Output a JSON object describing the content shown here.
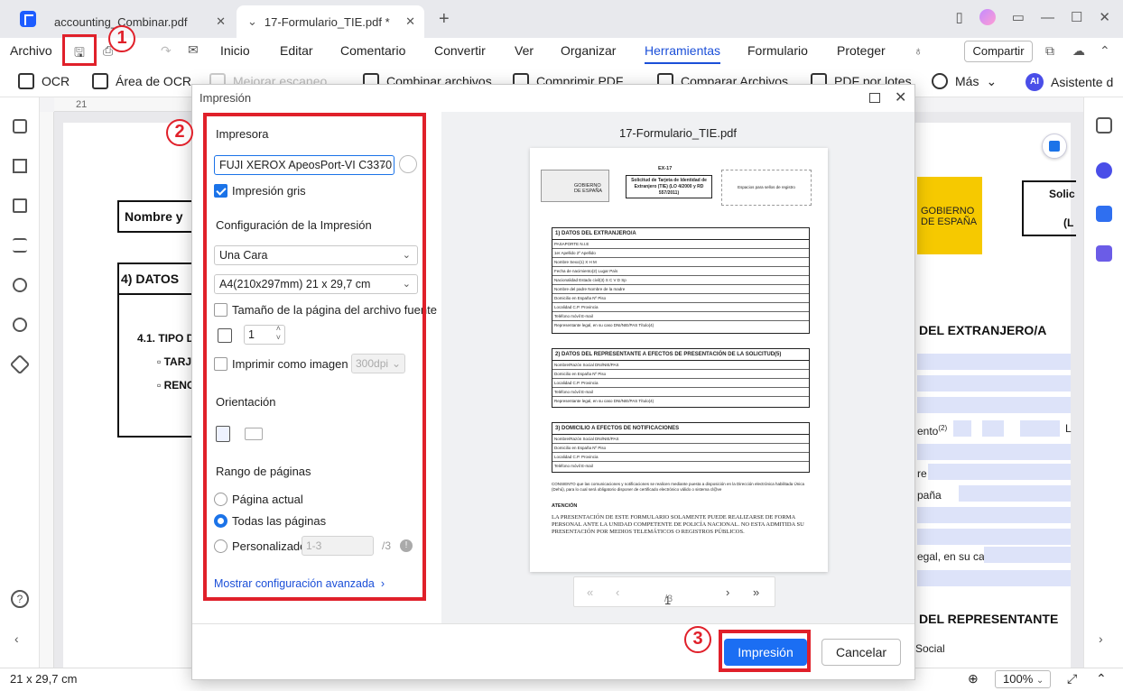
{
  "tabs": [
    {
      "label": "accounting_Combinar.pdf"
    },
    {
      "label": "17-Formulario_TIE.pdf *"
    }
  ],
  "menu": {
    "archivo": "Archivo",
    "items": [
      "Inicio",
      "Editar",
      "Comentario",
      "Convertir",
      "Ver",
      "Organizar",
      "Herramientas",
      "Formulario",
      "Proteger"
    ],
    "active": "Herramientas",
    "share": "Compartir"
  },
  "toolbar": {
    "ocr": "OCR",
    "ocr_area": "Área de OCR",
    "improve_scan": "Mejorar escaneo",
    "combine": "Combinar archivos",
    "compress": "Comprimir PDF",
    "compare": "Comparar Archivos",
    "batch": "PDF por lotes",
    "more": "Más",
    "assistant": "Asistente d",
    "ai": "AI"
  },
  "ruler": {
    "first_tick": "21"
  },
  "document": {
    "name_label": "Nombre y",
    "section4": "4)  DATOS",
    "sub41": "4.1. TIPO D",
    "opt1": "TARJ",
    "opt2": "RENO",
    "gob_es": "GOBIERNO DE ESPAÑA",
    "solic": "Solic",
    "solic2": "(L",
    "extranjero": "DEL EXTRANJERO/A",
    "nacimiento": "ento",
    "nacimiento_sup": "(2)",
    "l": "L",
    "re": "re",
    "pana": "paña",
    "legal": "egal, en su caso",
    "representante": "DEL REPRESENTANTE",
    "social": "Social"
  },
  "status": {
    "size": "21 x 29,7 cm",
    "zoom": "100%"
  },
  "dialog": {
    "title": "Impresión",
    "printer_section": "Impresora",
    "printer": "FUJI XEROX ApeosPort-VI C3370",
    "grayscale": "Impresión gris",
    "config_section": "Configuración de la Impresión",
    "sides": "Una Cara",
    "paper": "A4(210x297mm) 21 x 29,7 cm",
    "source_size": "Tamaño de la página del archivo fuente",
    "copies": "1",
    "print_as_image": "Imprimir como imagen",
    "dpi": "300dpi",
    "orientation_section": "Orientación",
    "range_section": "Rango de páginas",
    "current_page": "Página actual",
    "all_pages": "Todas las páginas",
    "custom": "Personalizado",
    "custom_placeholder": "1-3",
    "custom_total": "/3",
    "advanced": "Mostrar configuración avanzada",
    "preview_name": "17-Formulario_TIE.pdf",
    "page_current": "1",
    "page_total": "/3",
    "print_button": "Impresión",
    "cancel_button": "Cancelar"
  },
  "preview_doc": {
    "ex": "EX-17",
    "doc_title": "Solicitud de Tarjeta de Identidad de Extranjero (TIE) (LO 4/2000 y RD 557/2011)",
    "register": "Espacios para sellos de registro",
    "gov": "GOBIERNO DE ESPAÑA",
    "sec1": "1)  DATOS DEL EXTRANJERO/A",
    "sec1_rows": [
      "PASAPORTE                                        N.I.E",
      "1er Apellido                                            2º Apellido",
      "Nombre                                                    Sexo(1)   X    H    M",
      "Fecha de nacimiento(2)        Lugar                        País",
      "Nacionalidad                                          Estado civil(3)  S   C   V   D   Sp",
      "Nombre del padre                                  Nombre de la madre",
      "Domicilio en España                                            Nº       Piso",
      "Localidad                          C.P.                Provincia",
      "Teléfono móvil                          E-mail",
      "Representante legal, en su caso                      DNI/NIE/PAS        Título(4)"
    ],
    "sec2": "2)  DATOS DEL REPRESENTANTE A EFECTOS DE PRESENTACIÓN DE LA SOLICITUD(5)",
    "sec2_rows": [
      "Nombre/Razón Social                                  DNI/NIE/PAS",
      "Domicilio en España                                        Nº        Piso",
      "Localidad                         C.P.               Provincia",
      "Teléfono móvil                         E-mail",
      "Representante legal, en su caso                DNI/NIE/PAS          Título(4)"
    ],
    "sec3": "3)  DOMICILIO A EFECTOS DE NOTIFICACIONES",
    "sec3_rows": [
      "Nombre/Razón Social                                  DNI/NIE/PAS",
      "Domicilio en España                                        Nº        Piso",
      "Localidad                         C.P.               Provincia",
      "Teléfono móvil                         E-mail"
    ],
    "consent": "CONSIENTO que las comunicaciones y notificaciones se realicen mediante puesta a disposición en la Dirección electrónica habilitada Única (Dehú), para lo cual será obligatorio disponer de certificado electrónico válido o sistema cl@ve",
    "attention": "ATENCIÓN",
    "attention_text": "LA PRESENTACIÓN DE ESTE FORMULARIO SOLAMENTE PUEDE REALIZARSE DE FORMA PERSONAL ANTE LA UNIDAD COMPETENTE DE POLICÍA NACIONAL. NO ESTA ADMITIDA SU PRESENTACIÓN POR MEDIOS TELEMÁTICOS O REGISTROS PÚBLICOS."
  },
  "annotations": {
    "step1": "1",
    "step2": "2",
    "step3": "3"
  },
  "colors": {
    "accent": "#1b6ef3",
    "highlight": "#e0202a",
    "gov_yellow": "#f6c900"
  }
}
